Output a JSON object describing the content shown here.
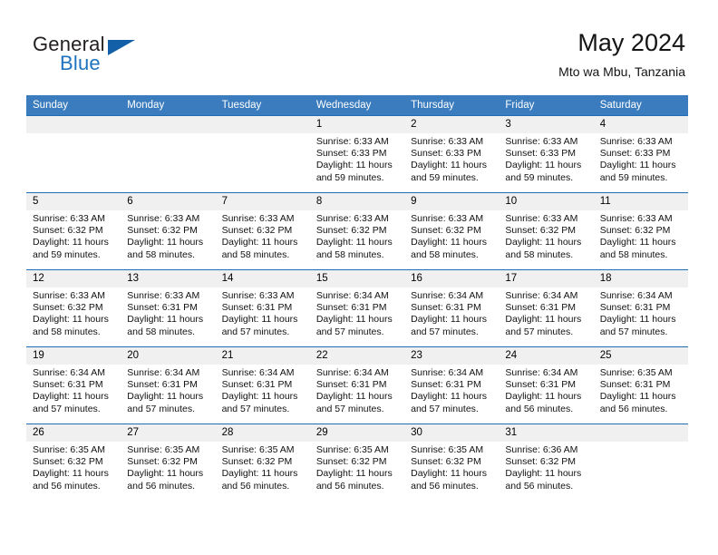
{
  "brand": {
    "name_part1": "General",
    "name_part2": "Blue",
    "accent_color": "#1360a8",
    "logo_icon": "triangle-icon"
  },
  "header": {
    "title": "May 2024",
    "subtitle": "Mto wa Mbu, Tanzania"
  },
  "calendar": {
    "header_bg": "#3a7cbe",
    "daynum_bg": "#f0f0f0",
    "weekday_headers": [
      "Sunday",
      "Monday",
      "Tuesday",
      "Wednesday",
      "Thursday",
      "Friday",
      "Saturday"
    ],
    "weeks": [
      [
        {
          "day": "",
          "blank": true
        },
        {
          "day": "",
          "blank": true
        },
        {
          "day": "",
          "blank": true
        },
        {
          "day": "1",
          "sunrise": "Sunrise: 6:33 AM",
          "sunset": "Sunset: 6:33 PM",
          "daylight_line1": "Daylight: 11 hours",
          "daylight_line2": "and 59 minutes."
        },
        {
          "day": "2",
          "sunrise": "Sunrise: 6:33 AM",
          "sunset": "Sunset: 6:33 PM",
          "daylight_line1": "Daylight: 11 hours",
          "daylight_line2": "and 59 minutes."
        },
        {
          "day": "3",
          "sunrise": "Sunrise: 6:33 AM",
          "sunset": "Sunset: 6:33 PM",
          "daylight_line1": "Daylight: 11 hours",
          "daylight_line2": "and 59 minutes."
        },
        {
          "day": "4",
          "sunrise": "Sunrise: 6:33 AM",
          "sunset": "Sunset: 6:33 PM",
          "daylight_line1": "Daylight: 11 hours",
          "daylight_line2": "and 59 minutes."
        }
      ],
      [
        {
          "day": "5",
          "sunrise": "Sunrise: 6:33 AM",
          "sunset": "Sunset: 6:32 PM",
          "daylight_line1": "Daylight: 11 hours",
          "daylight_line2": "and 59 minutes."
        },
        {
          "day": "6",
          "sunrise": "Sunrise: 6:33 AM",
          "sunset": "Sunset: 6:32 PM",
          "daylight_line1": "Daylight: 11 hours",
          "daylight_line2": "and 58 minutes."
        },
        {
          "day": "7",
          "sunrise": "Sunrise: 6:33 AM",
          "sunset": "Sunset: 6:32 PM",
          "daylight_line1": "Daylight: 11 hours",
          "daylight_line2": "and 58 minutes."
        },
        {
          "day": "8",
          "sunrise": "Sunrise: 6:33 AM",
          "sunset": "Sunset: 6:32 PM",
          "daylight_line1": "Daylight: 11 hours",
          "daylight_line2": "and 58 minutes."
        },
        {
          "day": "9",
          "sunrise": "Sunrise: 6:33 AM",
          "sunset": "Sunset: 6:32 PM",
          "daylight_line1": "Daylight: 11 hours",
          "daylight_line2": "and 58 minutes."
        },
        {
          "day": "10",
          "sunrise": "Sunrise: 6:33 AM",
          "sunset": "Sunset: 6:32 PM",
          "daylight_line1": "Daylight: 11 hours",
          "daylight_line2": "and 58 minutes."
        },
        {
          "day": "11",
          "sunrise": "Sunrise: 6:33 AM",
          "sunset": "Sunset: 6:32 PM",
          "daylight_line1": "Daylight: 11 hours",
          "daylight_line2": "and 58 minutes."
        }
      ],
      [
        {
          "day": "12",
          "sunrise": "Sunrise: 6:33 AM",
          "sunset": "Sunset: 6:32 PM",
          "daylight_line1": "Daylight: 11 hours",
          "daylight_line2": "and 58 minutes."
        },
        {
          "day": "13",
          "sunrise": "Sunrise: 6:33 AM",
          "sunset": "Sunset: 6:31 PM",
          "daylight_line1": "Daylight: 11 hours",
          "daylight_line2": "and 58 minutes."
        },
        {
          "day": "14",
          "sunrise": "Sunrise: 6:33 AM",
          "sunset": "Sunset: 6:31 PM",
          "daylight_line1": "Daylight: 11 hours",
          "daylight_line2": "and 57 minutes."
        },
        {
          "day": "15",
          "sunrise": "Sunrise: 6:34 AM",
          "sunset": "Sunset: 6:31 PM",
          "daylight_line1": "Daylight: 11 hours",
          "daylight_line2": "and 57 minutes."
        },
        {
          "day": "16",
          "sunrise": "Sunrise: 6:34 AM",
          "sunset": "Sunset: 6:31 PM",
          "daylight_line1": "Daylight: 11 hours",
          "daylight_line2": "and 57 minutes."
        },
        {
          "day": "17",
          "sunrise": "Sunrise: 6:34 AM",
          "sunset": "Sunset: 6:31 PM",
          "daylight_line1": "Daylight: 11 hours",
          "daylight_line2": "and 57 minutes."
        },
        {
          "day": "18",
          "sunrise": "Sunrise: 6:34 AM",
          "sunset": "Sunset: 6:31 PM",
          "daylight_line1": "Daylight: 11 hours",
          "daylight_line2": "and 57 minutes."
        }
      ],
      [
        {
          "day": "19",
          "sunrise": "Sunrise: 6:34 AM",
          "sunset": "Sunset: 6:31 PM",
          "daylight_line1": "Daylight: 11 hours",
          "daylight_line2": "and 57 minutes."
        },
        {
          "day": "20",
          "sunrise": "Sunrise: 6:34 AM",
          "sunset": "Sunset: 6:31 PM",
          "daylight_line1": "Daylight: 11 hours",
          "daylight_line2": "and 57 minutes."
        },
        {
          "day": "21",
          "sunrise": "Sunrise: 6:34 AM",
          "sunset": "Sunset: 6:31 PM",
          "daylight_line1": "Daylight: 11 hours",
          "daylight_line2": "and 57 minutes."
        },
        {
          "day": "22",
          "sunrise": "Sunrise: 6:34 AM",
          "sunset": "Sunset: 6:31 PM",
          "daylight_line1": "Daylight: 11 hours",
          "daylight_line2": "and 57 minutes."
        },
        {
          "day": "23",
          "sunrise": "Sunrise: 6:34 AM",
          "sunset": "Sunset: 6:31 PM",
          "daylight_line1": "Daylight: 11 hours",
          "daylight_line2": "and 57 minutes."
        },
        {
          "day": "24",
          "sunrise": "Sunrise: 6:34 AM",
          "sunset": "Sunset: 6:31 PM",
          "daylight_line1": "Daylight: 11 hours",
          "daylight_line2": "and 56 minutes."
        },
        {
          "day": "25",
          "sunrise": "Sunrise: 6:35 AM",
          "sunset": "Sunset: 6:31 PM",
          "daylight_line1": "Daylight: 11 hours",
          "daylight_line2": "and 56 minutes."
        }
      ],
      [
        {
          "day": "26",
          "sunrise": "Sunrise: 6:35 AM",
          "sunset": "Sunset: 6:32 PM",
          "daylight_line1": "Daylight: 11 hours",
          "daylight_line2": "and 56 minutes."
        },
        {
          "day": "27",
          "sunrise": "Sunrise: 6:35 AM",
          "sunset": "Sunset: 6:32 PM",
          "daylight_line1": "Daylight: 11 hours",
          "daylight_line2": "and 56 minutes."
        },
        {
          "day": "28",
          "sunrise": "Sunrise: 6:35 AM",
          "sunset": "Sunset: 6:32 PM",
          "daylight_line1": "Daylight: 11 hours",
          "daylight_line2": "and 56 minutes."
        },
        {
          "day": "29",
          "sunrise": "Sunrise: 6:35 AM",
          "sunset": "Sunset: 6:32 PM",
          "daylight_line1": "Daylight: 11 hours",
          "daylight_line2": "and 56 minutes."
        },
        {
          "day": "30",
          "sunrise": "Sunrise: 6:35 AM",
          "sunset": "Sunset: 6:32 PM",
          "daylight_line1": "Daylight: 11 hours",
          "daylight_line2": "and 56 minutes."
        },
        {
          "day": "31",
          "sunrise": "Sunrise: 6:36 AM",
          "sunset": "Sunset: 6:32 PM",
          "daylight_line1": "Daylight: 11 hours",
          "daylight_line2": "and 56 minutes."
        },
        {
          "day": "",
          "blank": true
        }
      ]
    ]
  }
}
